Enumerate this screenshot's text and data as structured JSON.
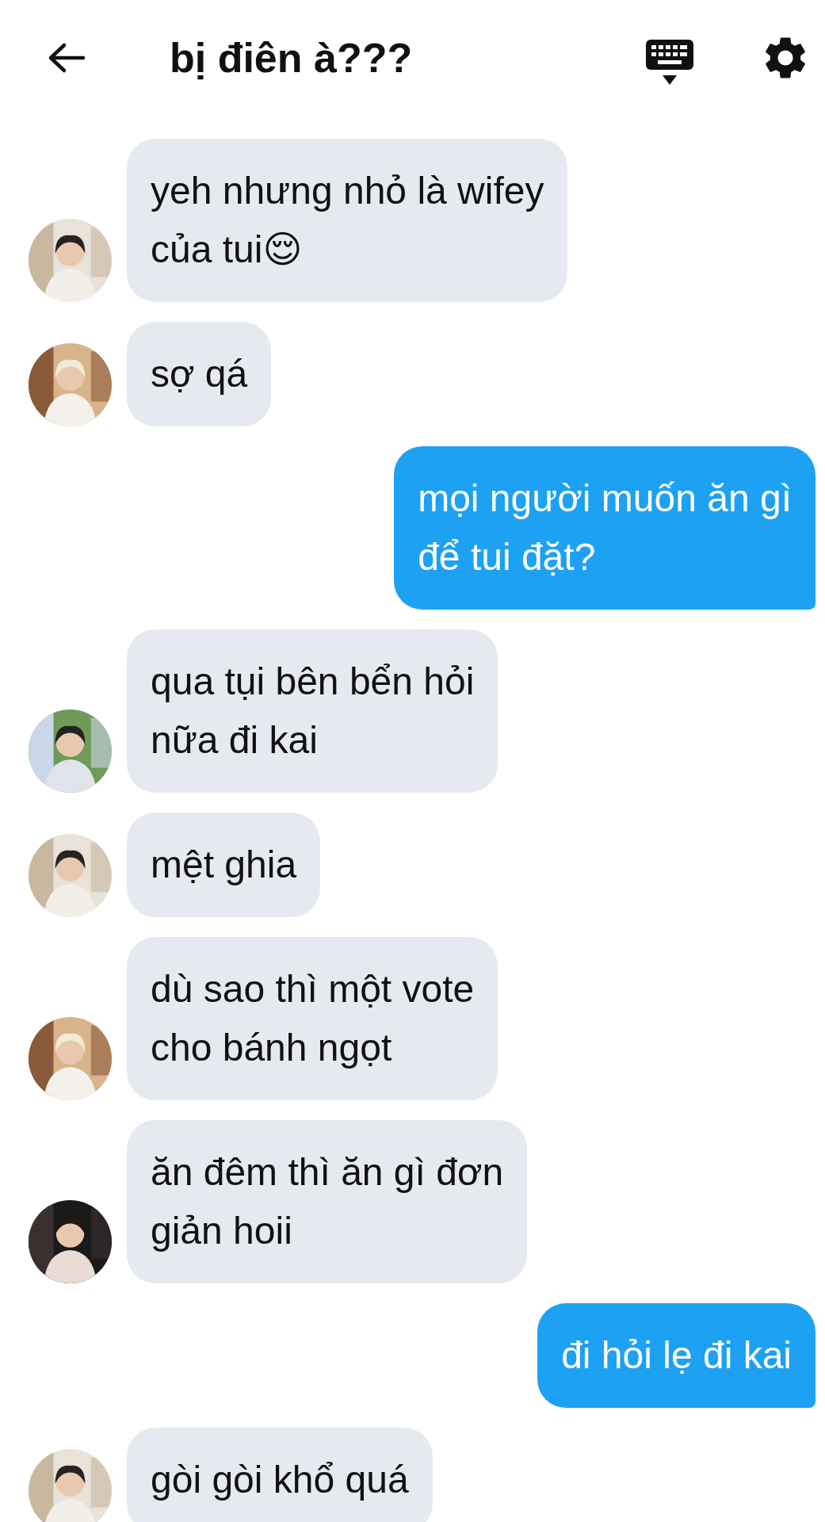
{
  "header": {
    "title": "bị điên à???"
  },
  "messages": [
    {
      "kind": "received",
      "lines": [
        "yeh nhưng nhỏ là wifey",
        "của tui😌"
      ]
    },
    {
      "kind": "received",
      "lines": [
        "sợ qá"
      ]
    },
    {
      "kind": "sent",
      "lines": [
        "mọi người muốn ăn gì",
        "để tui đặt?"
      ]
    },
    {
      "kind": "received",
      "lines": [
        "qua tụi bên bển hỏi",
        "nữa đi kai"
      ]
    },
    {
      "kind": "received",
      "lines": [
        "mệt ghia"
      ]
    },
    {
      "kind": "received",
      "lines": [
        "dù sao thì một vote",
        "cho bánh ngọt"
      ]
    },
    {
      "kind": "received",
      "lines": [
        "ăn đêm thì ăn gì đơn",
        "giản hoii"
      ]
    },
    {
      "kind": "sent",
      "lines": [
        "đi hỏi lẹ đi kai"
      ]
    },
    {
      "kind": "received",
      "lines": [
        "gòi gòi khổ quá"
      ]
    }
  ]
}
